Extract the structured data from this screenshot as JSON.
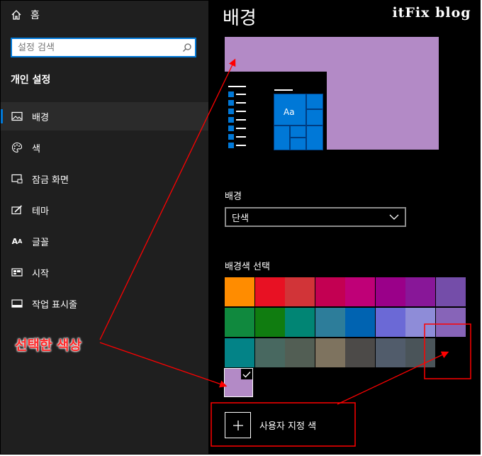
{
  "sidebar": {
    "home_label": "홈",
    "search_placeholder": "설정 검색",
    "section_title": "개인 설정",
    "items": [
      {
        "label": "배경",
        "icon": "picture-icon",
        "active": true
      },
      {
        "label": "색",
        "icon": "palette-icon",
        "active": false
      },
      {
        "label": "잠금 화면",
        "icon": "lock-screen-icon",
        "active": false
      },
      {
        "label": "테마",
        "icon": "theme-brush-icon",
        "active": false
      },
      {
        "label": "글꼴",
        "icon": "font-icon",
        "active": false
      },
      {
        "label": "시작",
        "icon": "start-tiles-icon",
        "active": false
      },
      {
        "label": "작업 표시줄",
        "icon": "taskbar-icon",
        "active": false
      }
    ]
  },
  "main": {
    "title": "배경",
    "watermark": "itFix blog",
    "preview": {
      "background_color": "#b38ac6",
      "tile_text": "Aa",
      "accent_color": "#0078d7"
    },
    "background_label": "배경",
    "background_value": "단색",
    "color_section_label": "배경색 선택",
    "swatch_rows": [
      [
        "#ff8c00",
        "#e81123",
        "#d13438",
        "#c30052",
        "#bf0077",
        "#9a0089",
        "#881798",
        "#744da9"
      ],
      [
        "#10893e",
        "#107c10",
        "#018574",
        "#2d7d9a",
        "#0063b1",
        "#6b69d6",
        "#8e8cd8",
        "#8764b8"
      ],
      [
        "#038387",
        "#486860",
        "#525e54",
        "#7e735f",
        "#4c4a48",
        "#515c6b",
        "#4a5459"
      ]
    ],
    "selected_color": "#b38ac6",
    "custom_color_label": "사용자 지정 색"
  },
  "annotation": {
    "label": "선택한 색상",
    "color": "#ff2a2a"
  }
}
